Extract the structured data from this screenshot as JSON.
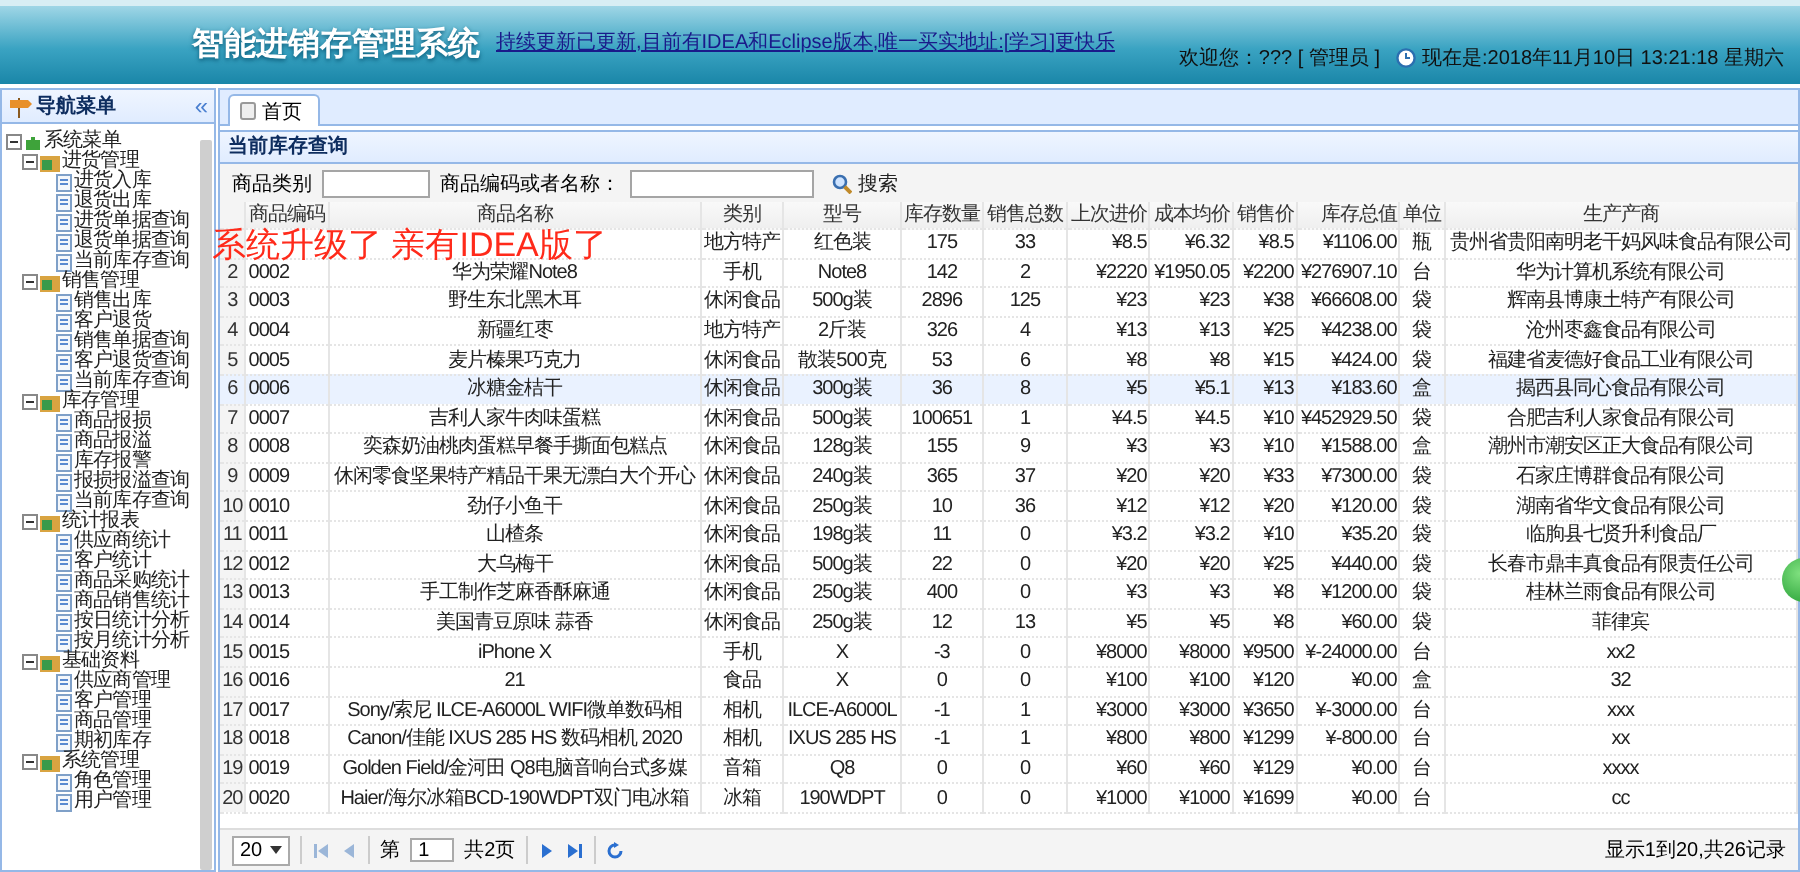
{
  "header": {
    "title": "智能进销存管理系统",
    "notice": "持续更新已更新,目前有IDEA和Eclipse版本,唯一买实地址:[学习]更快乐",
    "welcome": "欢迎您：??? [ 管理员 ]",
    "clock": "现在是:2018年11月10日 13:21:18 星期六"
  },
  "sidebar": {
    "title": "导航菜单",
    "collapse_glyph": "«",
    "tree": [
      {
        "label": "系统菜单",
        "expanded": true,
        "children": [
          {
            "label": "进货管理",
            "expanded": true,
            "children": [
              {
                "label": "进货入库"
              },
              {
                "label": "退货出库"
              },
              {
                "label": "进货单据查询"
              },
              {
                "label": "退货单据查询"
              },
              {
                "label": "当前库存查询"
              }
            ]
          },
          {
            "label": "销售管理",
            "expanded": true,
            "children": [
              {
                "label": "销售出库"
              },
              {
                "label": "客户退货"
              },
              {
                "label": "销售单据查询"
              },
              {
                "label": "客户退货查询"
              },
              {
                "label": "当前库存查询"
              }
            ]
          },
          {
            "label": "库存管理",
            "expanded": true,
            "children": [
              {
                "label": "商品报损"
              },
              {
                "label": "商品报溢"
              },
              {
                "label": "库存报警"
              },
              {
                "label": "报损报溢查询"
              },
              {
                "label": "当前库存查询"
              }
            ]
          },
          {
            "label": "统计报表",
            "expanded": true,
            "children": [
              {
                "label": "供应商统计"
              },
              {
                "label": "客户统计"
              },
              {
                "label": "商品采购统计"
              },
              {
                "label": "商品销售统计"
              },
              {
                "label": "按日统计分析"
              },
              {
                "label": "按月统计分析"
              }
            ]
          },
          {
            "label": "基础资料",
            "expanded": true,
            "children": [
              {
                "label": "供应商管理"
              },
              {
                "label": "客户管理"
              },
              {
                "label": "商品管理"
              },
              {
                "label": "期初库存"
              }
            ]
          },
          {
            "label": "系统管理",
            "expanded": true,
            "children": [
              {
                "label": "角色管理"
              },
              {
                "label": "用户管理"
              }
            ]
          }
        ]
      }
    ]
  },
  "tabs": [
    {
      "label": "首页",
      "selected": true
    }
  ],
  "panel": {
    "title": "当前库存查询",
    "filters": [
      {
        "label": "商品类别"
      },
      {
        "label": "商品编码或者名称："
      }
    ],
    "search_button": "搜索",
    "overlay_notice": "系统升级了 亲有IDEA版了",
    "table": {
      "columns": [
        "商品编码",
        "商品名称",
        "类别",
        "型号",
        "库存数量",
        "销售总数",
        "上次进价",
        "成本均价",
        "销售价",
        "库存总值",
        "单位",
        "生产产商"
      ],
      "rows": [
        {
          "category": "地方特产",
          "model": "红色装",
          "stock": "175",
          "sold": "33",
          "last_price": "¥8.5",
          "cost": "¥6.32",
          "price": "¥8.5",
          "total_value": "¥1106.00",
          "unit": "瓶",
          "producer": "贵州省贵阳南明老干妈风味食品有限公司",
          "selected": false
        },
        {
          "number": "2",
          "code": "0002",
          "name": "华为荣耀Note8",
          "category": "手机",
          "model": "Note8",
          "stock": "142",
          "sold": "2",
          "last_price": "¥2220",
          "cost": "¥1950.05",
          "price": "¥2200",
          "total_value": "¥276907.10",
          "unit": "台",
          "producer": "华为计算机系统有限公司",
          "selected": false
        },
        {
          "number": "3",
          "code": "0003",
          "name": "野生东北黑木耳",
          "category": "休闲食品",
          "model": "500g装",
          "stock": "2896",
          "sold": "125",
          "last_price": "¥23",
          "cost": "¥23",
          "price": "¥38",
          "total_value": "¥66608.00",
          "unit": "袋",
          "producer": "辉南县博康土特产有限公司",
          "selected": false
        },
        {
          "number": "4",
          "code": "0004",
          "name": "新疆红枣",
          "category": "地方特产",
          "model": "2斤装",
          "stock": "326",
          "sold": "4",
          "last_price": "¥13",
          "cost": "¥13",
          "price": "¥25",
          "total_value": "¥4238.00",
          "unit": "袋",
          "producer": "沧州枣鑫食品有限公司",
          "selected": false
        },
        {
          "number": "5",
          "code": "0005",
          "name": "麦片榛果巧克力",
          "category": "休闲食品",
          "model": "散装500克",
          "stock": "53",
          "sold": "6",
          "last_price": "¥8",
          "cost": "¥8",
          "price": "¥15",
          "total_value": "¥424.00",
          "unit": "袋",
          "producer": "福建省麦德好食品工业有限公司",
          "selected": false
        },
        {
          "number": "6",
          "code": "0006",
          "name": "冰糖金桔干",
          "category": "休闲食品",
          "model": "300g装",
          "stock": "36",
          "sold": "8",
          "last_price": "¥5",
          "cost": "¥5.1",
          "price": "¥13",
          "total_value": "¥183.60",
          "unit": "盒",
          "producer": "揭西县同心食品有限公司",
          "selected": true
        },
        {
          "number": "7",
          "code": "0007",
          "name": "吉利人家牛肉味蛋糕",
          "category": "休闲食品",
          "model": "500g装",
          "stock": "100651",
          "sold": "1",
          "last_price": "¥4.5",
          "cost": "¥4.5",
          "price": "¥10",
          "total_value": "¥452929.50",
          "unit": "袋",
          "producer": "合肥吉利人家食品有限公司",
          "selected": false
        },
        {
          "number": "8",
          "code": "0008",
          "name": "奕森奶油桃肉蛋糕早餐手撕面包糕点",
          "category": "休闲食品",
          "model": "128g装",
          "stock": "155",
          "sold": "9",
          "last_price": "¥3",
          "cost": "¥3",
          "price": "¥10",
          "total_value": "¥1588.00",
          "unit": "盒",
          "producer": "潮州市潮安区正大食品有限公司",
          "selected": false
        },
        {
          "number": "9",
          "code": "0009",
          "name": "休闲零食坚果特产精品干果无漂白大个开心",
          "category": "休闲食品",
          "model": "240g装",
          "stock": "365",
          "sold": "37",
          "last_price": "¥20",
          "cost": "¥20",
          "price": "¥33",
          "total_value": "¥7300.00",
          "unit": "袋",
          "producer": "石家庄博群食品有限公司",
          "selected": false
        },
        {
          "number": "10",
          "code": "0010",
          "name": "劲仔小鱼干",
          "category": "休闲食品",
          "model": "250g装",
          "stock": "10",
          "sold": "36",
          "last_price": "¥12",
          "cost": "¥12",
          "price": "¥20",
          "total_value": "¥120.00",
          "unit": "袋",
          "producer": "湖南省华文食品有限公司",
          "selected": false
        },
        {
          "number": "11",
          "code": "0011",
          "name": "山楂条",
          "category": "休闲食品",
          "model": "198g装",
          "stock": "11",
          "sold": "0",
          "last_price": "¥3.2",
          "cost": "¥3.2",
          "price": "¥10",
          "total_value": "¥35.20",
          "unit": "袋",
          "producer": "临朐县七贤升利食品厂",
          "selected": false
        },
        {
          "number": "12",
          "code": "0012",
          "name": "大乌梅干",
          "category": "休闲食品",
          "model": "500g装",
          "stock": "22",
          "sold": "0",
          "last_price": "¥20",
          "cost": "¥20",
          "price": "¥25",
          "total_value": "¥440.00",
          "unit": "袋",
          "producer": "长春市鼎丰真食品有限责任公司",
          "selected": false
        },
        {
          "number": "13",
          "code": "0013",
          "name": "手工制作芝麻香酥麻通",
          "category": "休闲食品",
          "model": "250g装",
          "stock": "400",
          "sold": "0",
          "last_price": "¥3",
          "cost": "¥3",
          "price": "¥8",
          "total_value": "¥1200.00",
          "unit": "袋",
          "producer": "桂林兰雨食品有限公司",
          "selected": false
        },
        {
          "number": "14",
          "code": "0014",
          "name": "美国青豆原味 蒜香",
          "category": "休闲食品",
          "model": "250g装",
          "stock": "12",
          "sold": "13",
          "last_price": "¥5",
          "cost": "¥5",
          "price": "¥8",
          "total_value": "¥60.00",
          "unit": "袋",
          "producer": "菲律宾",
          "selected": false
        },
        {
          "number": "15",
          "code": "0015",
          "name": "iPhone X",
          "category": "手机",
          "model": "X",
          "stock": "-3",
          "sold": "0",
          "last_price": "¥8000",
          "cost": "¥8000",
          "price": "¥9500",
          "total_value": "¥-24000.00",
          "unit": "台",
          "producer": "xx2",
          "selected": false
        },
        {
          "number": "16",
          "code": "0016",
          "name": "21",
          "category": "食品",
          "model": "X",
          "stock": "0",
          "sold": "0",
          "last_price": "¥100",
          "cost": "¥100",
          "price": "¥120",
          "total_value": "¥0.00",
          "unit": "盒",
          "producer": "32",
          "selected": false
        },
        {
          "number": "17",
          "code": "0017",
          "name": "Sony/索尼 ILCE-A6000L WIFI微单数码相",
          "category": "相机",
          "model": "ILCE-A6000L",
          "stock": "-1",
          "sold": "1",
          "last_price": "¥3000",
          "cost": "¥3000",
          "price": "¥3650",
          "total_value": "¥-3000.00",
          "unit": "台",
          "producer": "xxx",
          "selected": false
        },
        {
          "number": "18",
          "code": "0018",
          "name": "Canon/佳能 IXUS 285 HS 数码相机 2020",
          "category": "相机",
          "model": "IXUS 285 HS",
          "stock": "-1",
          "sold": "1",
          "last_price": "¥800",
          "cost": "¥800",
          "price": "¥1299",
          "total_value": "¥-800.00",
          "unit": "台",
          "producer": "xx",
          "selected": false
        },
        {
          "number": "19",
          "code": "0019",
          "name": "Golden Field/金河田 Q8电脑音响台式多媒",
          "category": "音箱",
          "model": "Q8",
          "stock": "0",
          "sold": "0",
          "last_price": "¥60",
          "cost": "¥60",
          "price": "¥129",
          "total_value": "¥0.00",
          "unit": "台",
          "producer": "xxxx",
          "selected": false
        },
        {
          "number": "20",
          "code": "0020",
          "name": "Haier/海尔冰箱BCD-190WDPT双门电冰箱",
          "category": "冰箱",
          "model": "190WDPT",
          "stock": "0",
          "sold": "0",
          "last_price": "¥1000",
          "cost": "¥1000",
          "price": "¥1699",
          "total_value": "¥0.00",
          "unit": "台",
          "producer": "cc",
          "selected": false
        }
      ]
    },
    "pager": {
      "page_size": "20",
      "page_label": "第",
      "page": "1",
      "total_pages": "共2页",
      "summary": "显示1到20,共26记录"
    }
  }
}
